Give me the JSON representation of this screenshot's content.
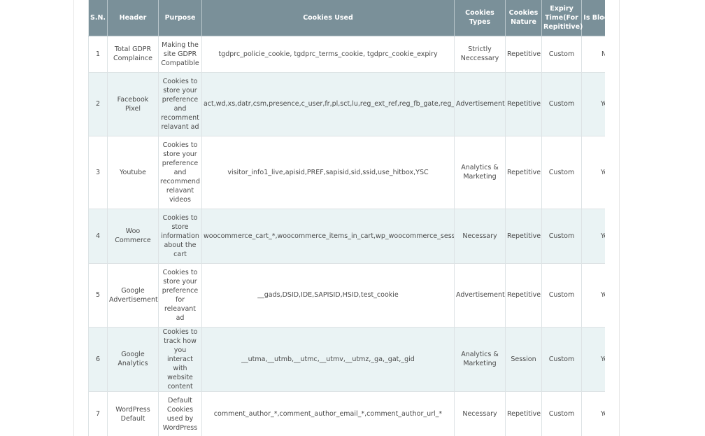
{
  "table": {
    "headers": [
      {
        "label": "S.N."
      },
      {
        "label": "Header"
      },
      {
        "label": "Purpose"
      },
      {
        "label": "Cookies Used"
      },
      {
        "label": "Cookies Types"
      },
      {
        "label": "Cookies Nature"
      },
      {
        "label": "Expiry Time(For Repititive)"
      },
      {
        "label": "Is Blockable"
      }
    ],
    "rows": [
      {
        "sn": "1",
        "header": "Total GDPR Complaince",
        "purpose": "Making the site GDPR Compatible",
        "cookies": "tgdprc_policie_cookie, tgdprc_terms_cookie, tgdprc_cookie_expiry",
        "type": "Strictly Neccessary",
        "nature": "Repetitive",
        "expiry": "Custom",
        "blockable": "No"
      },
      {
        "sn": "2",
        "header": "Facebook Pixel",
        "purpose": "Cookies to store your preference and recomment relavant ad",
        "cookies": "act,wd,xs,datr,csm,presence,c_user,fr,pl,sct,lu,reg_ext_ref,reg_fb_gate,reg_fb_ref",
        "type": "Advertisement",
        "nature": "Repetitive",
        "expiry": "Custom",
        "blockable": "Yes"
      },
      {
        "sn": "3",
        "header": "Youtube",
        "purpose": "Cookies to store your preference and recommend relavant videos",
        "cookies": "visitor_info1_live,apisid,PREF,sapisid,sid,ssid,use_hitbox,YSC",
        "type": "Analytics & Marketing",
        "nature": "Repetitive",
        "expiry": "Custom",
        "blockable": "Yes"
      },
      {
        "sn": "4",
        "header": "Woo Commerce",
        "purpose": "Cookies to store information about the cart",
        "cookies": "woocommerce_cart_*,woocommerce_items_in_cart,wp_woocommerce_session",
        "type": "Necessary",
        "nature": "Repetitive",
        "expiry": "Custom",
        "blockable": "Yes"
      },
      {
        "sn": "5",
        "header": "Google Advertisement",
        "purpose": "Cookies to store your preference for releavant ad",
        "cookies": "__gads,DSID,IDE,SAPISID,HSID,test_cookie",
        "type": "Advertisement",
        "nature": "Repetitive",
        "expiry": "Custom",
        "blockable": "Yes"
      },
      {
        "sn": "6",
        "header": "Google Analytics",
        "purpose": "Cookies to track how you interact with website content",
        "cookies": "__utma,__utmb,__utmc,__utmv,__utmz,_ga,_gat,_gid",
        "type": "Analytics & Marketing",
        "nature": "Session",
        "expiry": "Custom",
        "blockable": "Yes"
      },
      {
        "sn": "7",
        "header": "WordPress Default",
        "purpose": "Default Cookies used by WordPress",
        "cookies": "comment_author_*,comment_author_email_*,comment_author_url_*",
        "type": "Necessary",
        "nature": "Repetitive",
        "expiry": "Custom",
        "blockable": "Yes"
      }
    ]
  }
}
